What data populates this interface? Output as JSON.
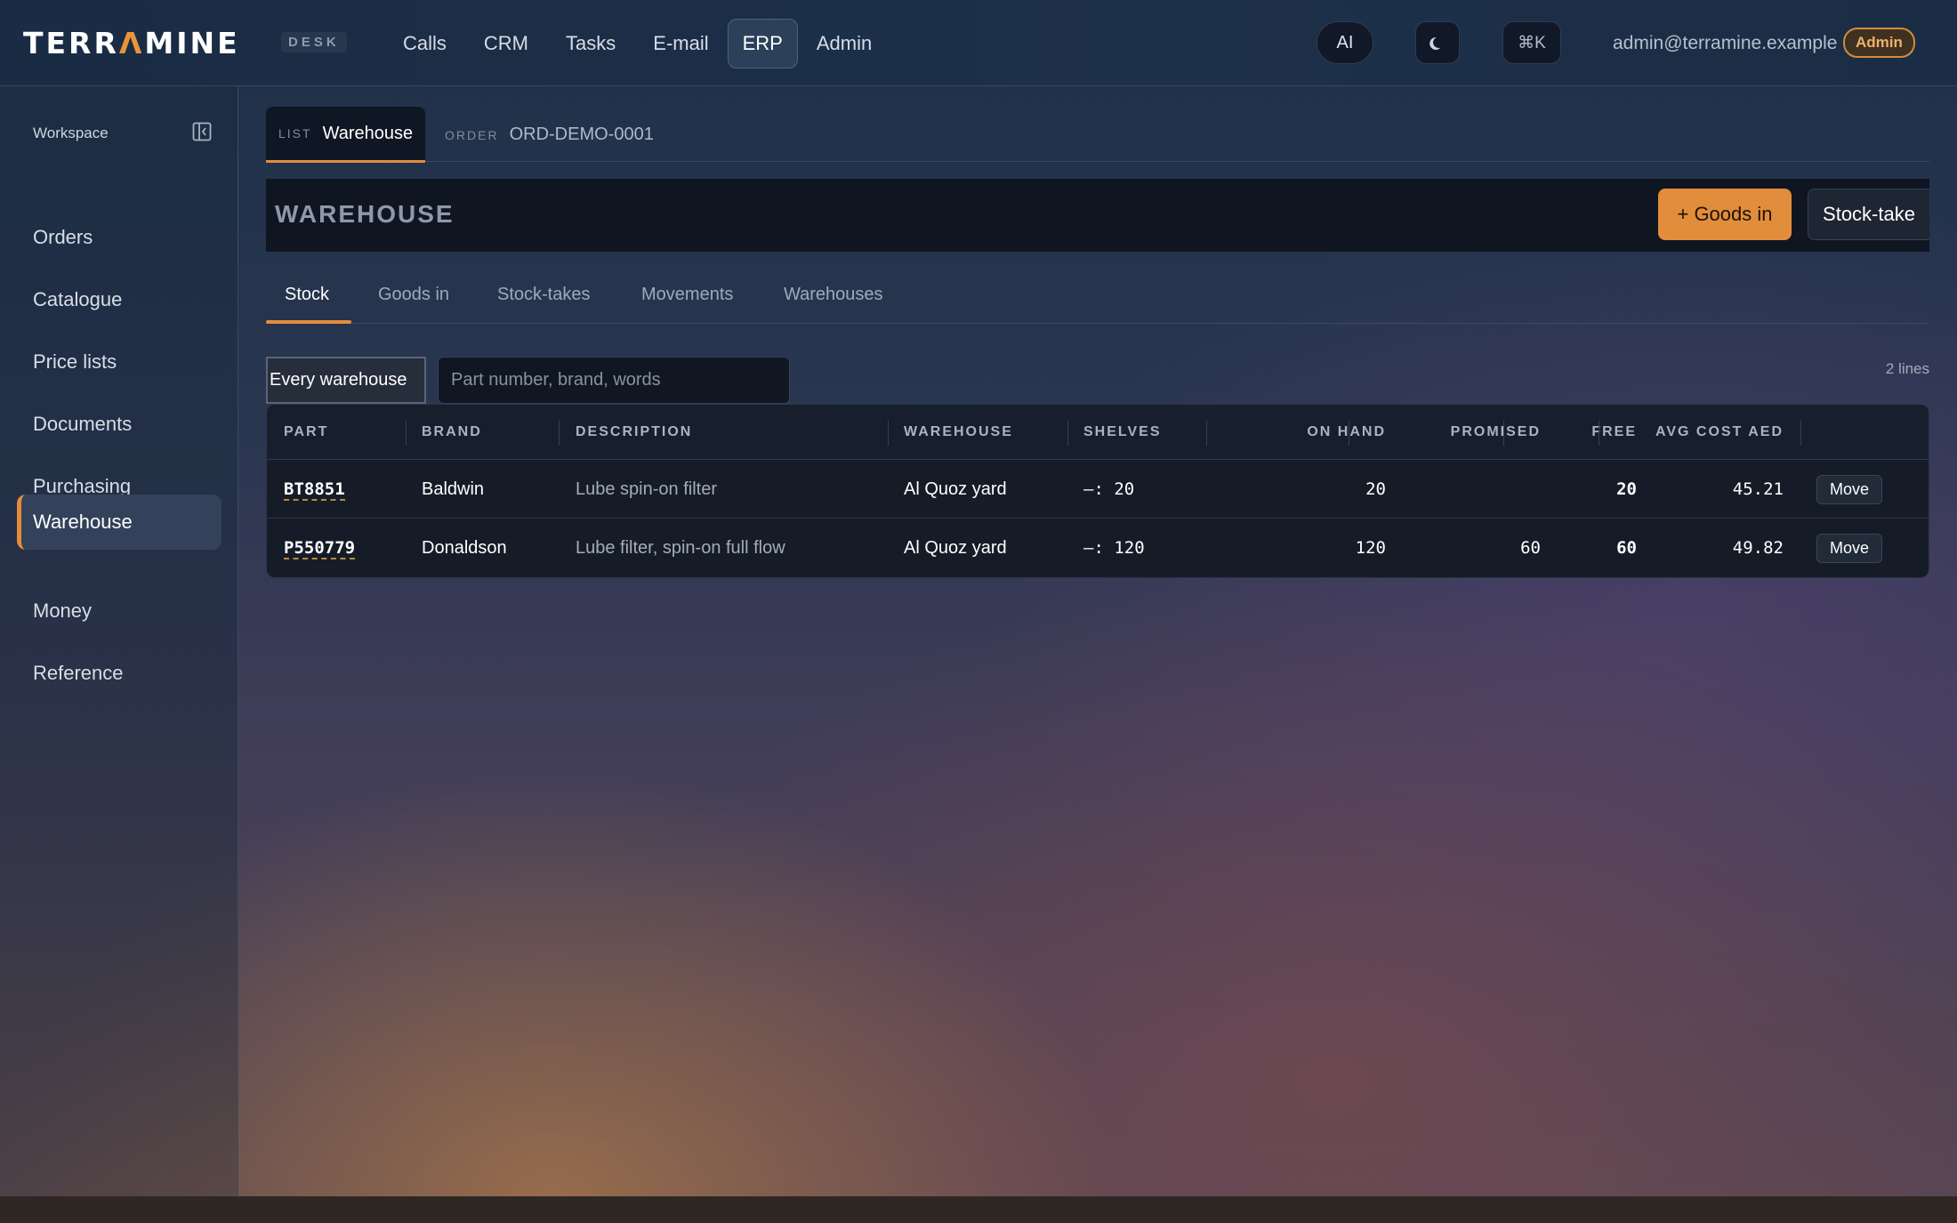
{
  "brand": {
    "logo_pre": "TERR",
    "logo_a": "Λ",
    "logo_post": "MINE",
    "tag": "DESK"
  },
  "nav": {
    "items": [
      "Calls",
      "CRM",
      "Tasks",
      "E-mail",
      "ERP",
      "Admin"
    ],
    "active": "ERP"
  },
  "topbar": {
    "ai_label": "AI",
    "theme_icon": "moon-icon",
    "cmdk_label": "⌘K",
    "user_email": "admin@terramine.example",
    "role": "Admin"
  },
  "sidebar": {
    "title": "Workspace",
    "items": [
      "Orders",
      "Catalogue",
      "Price lists",
      "Documents",
      "Purchasing",
      "Warehouse",
      "Money",
      "Reference"
    ],
    "active": "Warehouse"
  },
  "doc_tabs": [
    {
      "kind": "LIST",
      "title": "Warehouse",
      "active": true
    },
    {
      "kind": "ORDER",
      "title": "ORD-DEMO-0001",
      "active": false
    }
  ],
  "page": {
    "title": "WAREHOUSE",
    "primary_action": "+ Goods in",
    "secondary_action": "Stock-take"
  },
  "subtabs": {
    "items": [
      "Stock",
      "Goods in",
      "Stock-takes",
      "Movements",
      "Warehouses"
    ],
    "active": "Stock"
  },
  "filters": {
    "warehouse_value": "Every warehouse",
    "search_placeholder": "Part number, brand, words",
    "line_count": "2 lines"
  },
  "table": {
    "columns": [
      "PART",
      "BRAND",
      "DESCRIPTION",
      "WAREHOUSE",
      "SHELVES",
      "ON HAND",
      "PROMISED",
      "FREE",
      "AVG COST AED"
    ],
    "rows": [
      {
        "part": "BT8851",
        "brand": "Baldwin",
        "description": "Lube spin-on filter",
        "warehouse": "Al Quoz yard",
        "shelves": "—: 20",
        "on_hand": "20",
        "promised": "",
        "free": "20",
        "avg_cost": "45.21",
        "action": "Move"
      },
      {
        "part": "P550779",
        "brand": "Donaldson",
        "description": "Lube filter, spin-on full flow",
        "warehouse": "Al Quoz yard",
        "shelves": "—: 120",
        "on_hand": "120",
        "promised": "60",
        "free": "60",
        "avg_cost": "49.82",
        "action": "Move"
      }
    ]
  },
  "colors": {
    "accent": "#e28d3c",
    "topbar": "#1a2c44",
    "panel": "#151c28"
  }
}
